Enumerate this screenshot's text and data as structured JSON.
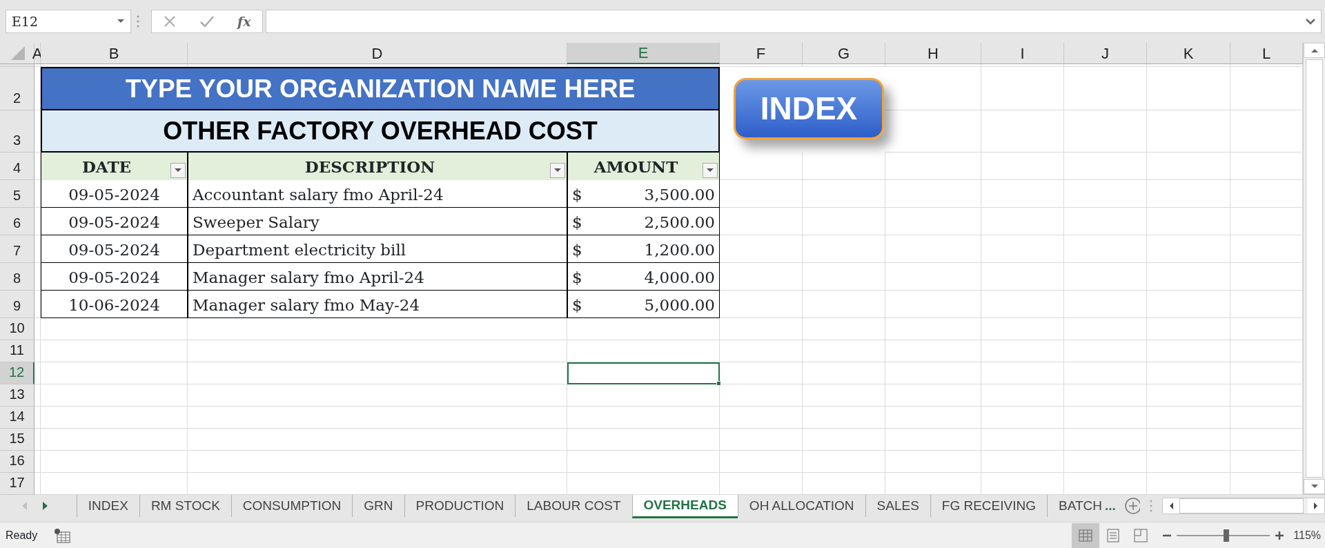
{
  "formula_bar": {
    "name_box": "E12",
    "function_button": "fx"
  },
  "columns": [
    {
      "label": "A",
      "selected": false
    },
    {
      "label": "B",
      "selected": false
    },
    {
      "label": "D",
      "selected": false
    },
    {
      "label": "E",
      "selected": true
    },
    {
      "label": "F",
      "selected": false
    },
    {
      "label": "G",
      "selected": false
    },
    {
      "label": "H",
      "selected": false
    },
    {
      "label": "I",
      "selected": false
    },
    {
      "label": "J",
      "selected": false
    },
    {
      "label": "K",
      "selected": false
    },
    {
      "label": "L",
      "selected": false
    }
  ],
  "rows": [
    {
      "label": "2",
      "selected": false
    },
    {
      "label": "3",
      "selected": false
    },
    {
      "label": "4",
      "selected": false
    },
    {
      "label": "5",
      "selected": false
    },
    {
      "label": "6",
      "selected": false
    },
    {
      "label": "7",
      "selected": false
    },
    {
      "label": "8",
      "selected": false
    },
    {
      "label": "9",
      "selected": false
    },
    {
      "label": "10",
      "selected": false
    },
    {
      "label": "11",
      "selected": false
    },
    {
      "label": "12",
      "selected": true
    },
    {
      "label": "13",
      "selected": false
    },
    {
      "label": "14",
      "selected": false
    },
    {
      "label": "15",
      "selected": false
    },
    {
      "label": "16",
      "selected": false
    },
    {
      "label": "17",
      "selected": false
    }
  ],
  "sheet": {
    "title": "TYPE YOUR ORGANIZATION NAME HERE",
    "subtitle": "OTHER FACTORY OVERHEAD COST",
    "table": {
      "columns": [
        "DATE",
        "DESCRIPTION",
        "AMOUNT"
      ],
      "rows": [
        {
          "date": "09-05-2024",
          "description": "Accountant salary fmo April-24",
          "currency": "$",
          "amount": "3,500.00"
        },
        {
          "date": "09-05-2024",
          "description": "Sweeper Salary",
          "currency": "$",
          "amount": "2,500.00"
        },
        {
          "date": "09-05-2024",
          "description": "Department electricity bill",
          "currency": "$",
          "amount": "1,200.00"
        },
        {
          "date": "09-05-2024",
          "description": "Manager salary fmo April-24",
          "currency": "$",
          "amount": "4,000.00"
        },
        {
          "date": "10-06-2024",
          "description": "Manager salary fmo May-24",
          "currency": "$",
          "amount": "5,000.00"
        }
      ]
    }
  },
  "index_button": "INDEX",
  "sheet_tabs": [
    {
      "label": "INDEX",
      "selected": false
    },
    {
      "label": "RM STOCK",
      "selected": false
    },
    {
      "label": "CONSUMPTION",
      "selected": false
    },
    {
      "label": "GRN",
      "selected": false
    },
    {
      "label": "PRODUCTION",
      "selected": false
    },
    {
      "label": "LABOUR COST",
      "selected": false
    },
    {
      "label": "OVERHEADS",
      "selected": true
    },
    {
      "label": "OH ALLOCATION",
      "selected": false
    },
    {
      "label": "SALES",
      "selected": false
    },
    {
      "label": "FG RECEIVING",
      "selected": false
    },
    {
      "label": "BATCH",
      "selected": false
    }
  ],
  "more_tabs": "...",
  "status_bar": {
    "status": "Ready",
    "views": [
      {
        "kind": "normal",
        "selected": true
      },
      {
        "kind": "page-layout",
        "selected": false
      },
      {
        "kind": "page-break",
        "selected": false
      }
    ],
    "zoom": {
      "level": 0.53,
      "reading": "115%"
    }
  }
}
